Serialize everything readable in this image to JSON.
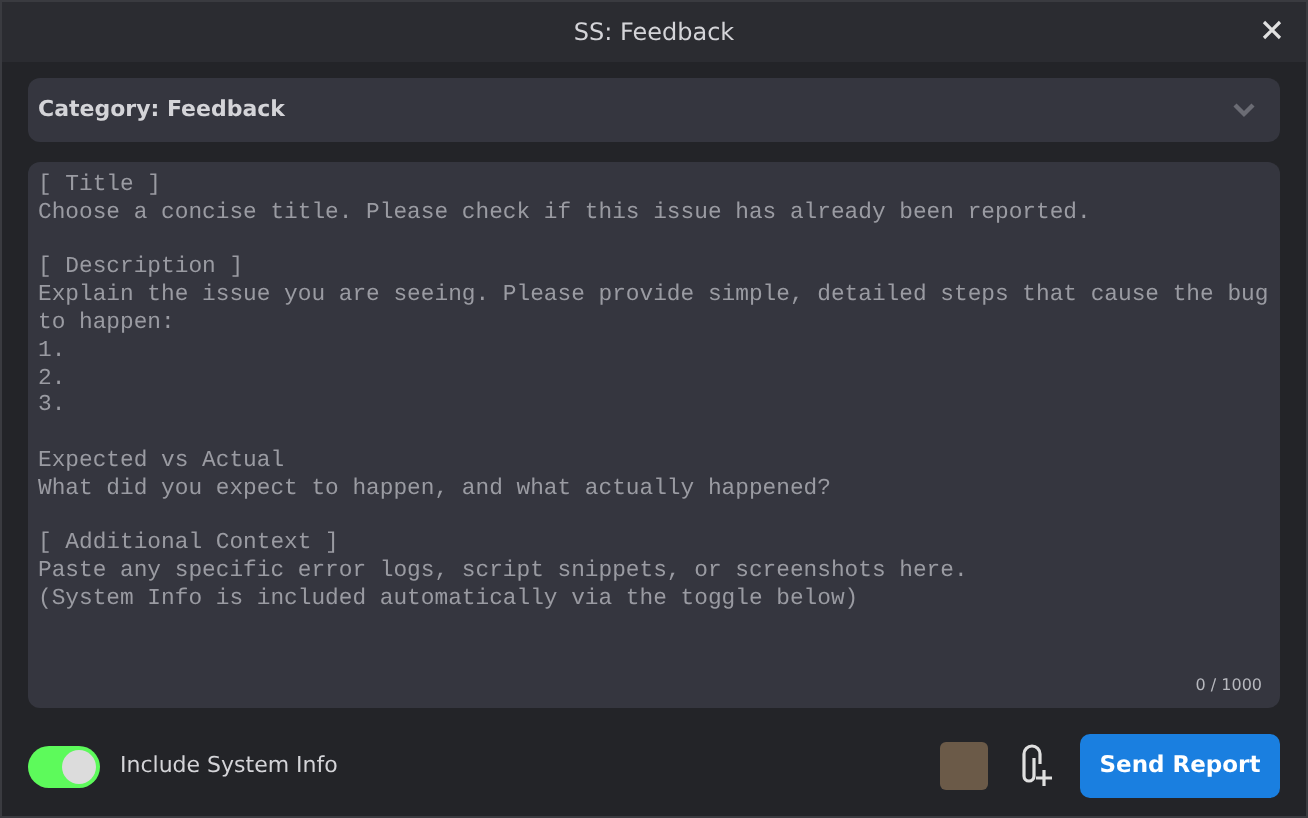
{
  "window": {
    "title": "SS: Feedback"
  },
  "category": {
    "label": "Category: Feedback"
  },
  "report": {
    "placeholder": "[ Title ]\nChoose a concise title. Please check if this issue has already been reported.\n\n[ Description ]\nExplain the issue you are seeing. Please provide simple, detailed steps that cause the bug to happen:\n1.\n2.\n3.\n\nExpected vs Actual\nWhat did you expect to happen, and what actually happened?\n\n[ Additional Context ]\nPaste any specific error logs, script snippets, or screenshots here.\n(System Info is included automatically via the toggle below)",
    "counter": "0 / 1000"
  },
  "system_info": {
    "label": "Include System Info",
    "on": true
  },
  "buttons": {
    "send": "Send Report"
  }
}
